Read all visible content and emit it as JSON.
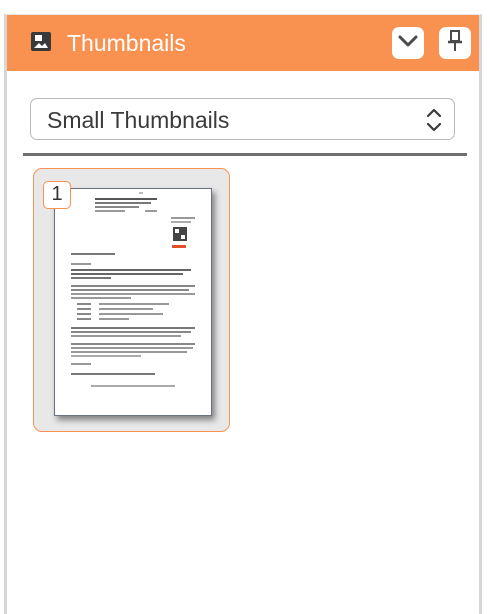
{
  "panel": {
    "title": "Thumbnails",
    "header_icon": "thumbnails-panel-icon",
    "collapse_icon": "chevron-down-icon",
    "pin_icon": "pin-icon"
  },
  "view_select": {
    "selected": "Small Thumbnails",
    "icon": "select-arrows-icon"
  },
  "thumbnails": [
    {
      "page_number": "1",
      "selected": true
    }
  ],
  "colors": {
    "accent": "#f99151",
    "card_bg": "#e8e8e8",
    "divider": "#6f6f6f"
  }
}
